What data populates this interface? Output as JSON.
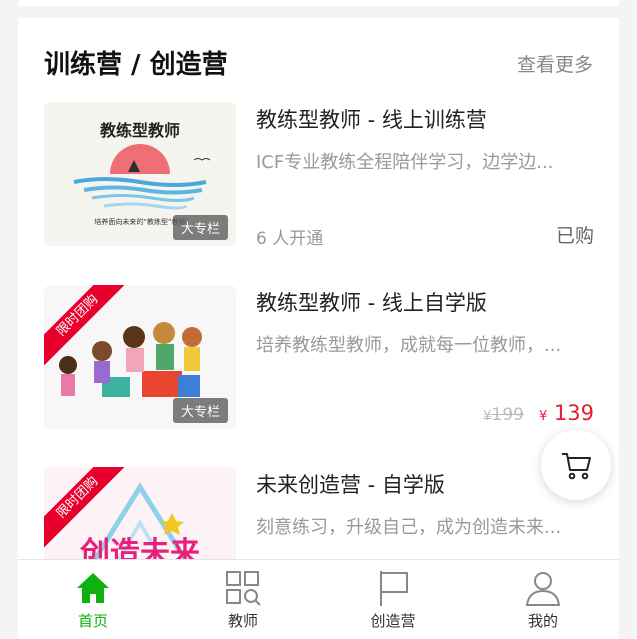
{
  "section": {
    "title": "训练营 / 创造营",
    "more_label": "查看更多"
  },
  "items": [
    {
      "title": "教练型教师 - 线上训练营",
      "desc": "ICF专业教练全程陪伴学习，边学边...",
      "tag": "大专栏",
      "meta": "6 人开通",
      "status": "已购",
      "thumb_heading": "教练型教师",
      "thumb_caption": "培养面向未来的“教练型”教师"
    },
    {
      "title": "教练型教师 - 线上自学版",
      "desc": "培养教练型教师，成就每一位教师，...",
      "tag": "大专栏",
      "ribbon": "限时团购",
      "price_old": "199",
      "price_new": "139",
      "currency": "¥"
    },
    {
      "title": "未来创造营 - 自学版",
      "desc": "刻意练习，升级自己，成为创造未来...",
      "ribbon": "限时团购",
      "thumb_art_text": "创造未来"
    }
  ],
  "cart": {
    "icon": "cart-icon"
  },
  "tabbar": {
    "tabs": [
      {
        "label": "首页",
        "icon": "home-icon",
        "active": true
      },
      {
        "label": "教师",
        "icon": "grid-search-icon",
        "active": false
      },
      {
        "label": "创造营",
        "icon": "flag-icon",
        "active": false
      },
      {
        "label": "我的",
        "icon": "user-icon",
        "active": false
      }
    ]
  },
  "colors": {
    "accent_green": "#0fb10f",
    "price_red": "#e61e2b",
    "ribbon_red": "#e8002d"
  }
}
